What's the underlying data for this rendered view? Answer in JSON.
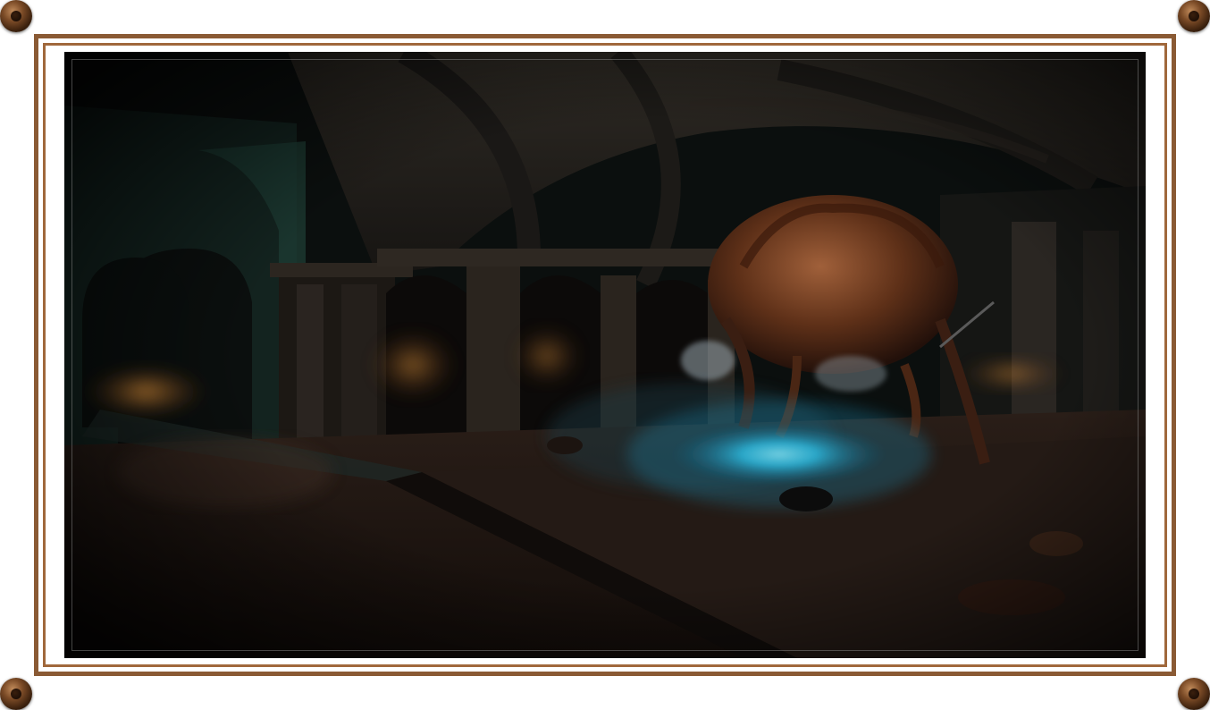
{
  "frame": {
    "color_outer": "#8a5a34",
    "color_inner": "#a0683c",
    "background": "#ffffff"
  },
  "scene": {
    "description_icons": [
      "rivet-icon"
    ],
    "palette": {
      "shadow": "#080b0b",
      "stone_green": "#1f3a33",
      "stone_brown": "#3a2a20",
      "creature": "#6a3a22",
      "magic_glow": "#36e0ff",
      "fire": "#d08a30"
    }
  }
}
